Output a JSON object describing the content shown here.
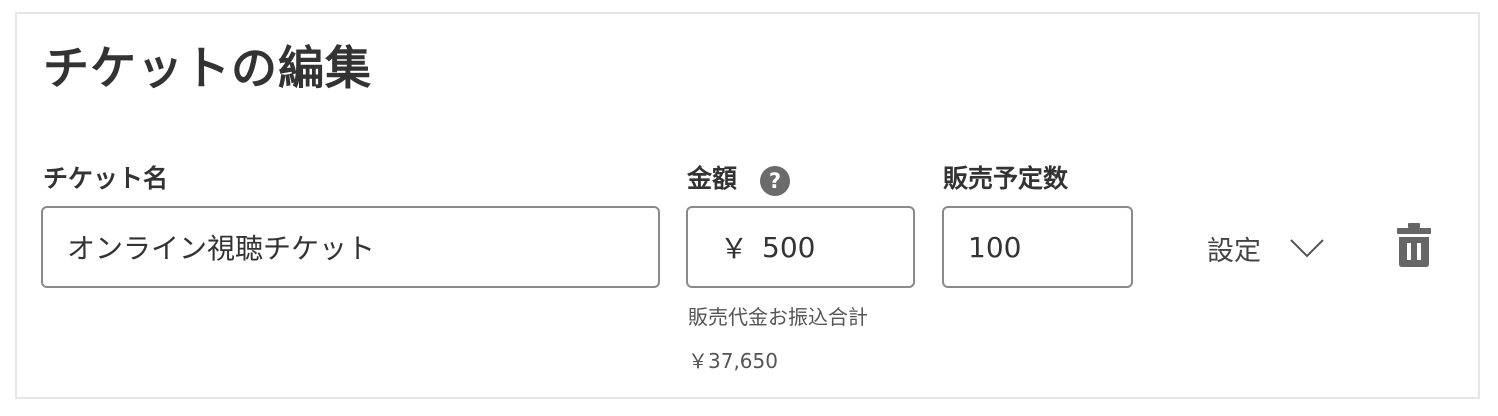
{
  "page": {
    "title": "チケットの編集"
  },
  "ticket": {
    "name_label": "チケット名",
    "name_value": "オンライン視聴チケット",
    "price_label": "金額",
    "price_currency": "￥",
    "price_value": "500",
    "quantity_label": "販売予定数",
    "quantity_value": "100",
    "payout_label": "販売代金お振込合計",
    "payout_value": "￥37,650",
    "settings_label": "設定"
  },
  "icons": {
    "help": "question-circle-icon",
    "chevron": "chevron-down-icon",
    "delete": "trash-icon"
  },
  "colors": {
    "text": "#333333",
    "border": "#8a8a8a",
    "icon": "#666666",
    "card_border": "#e6e6e6"
  }
}
